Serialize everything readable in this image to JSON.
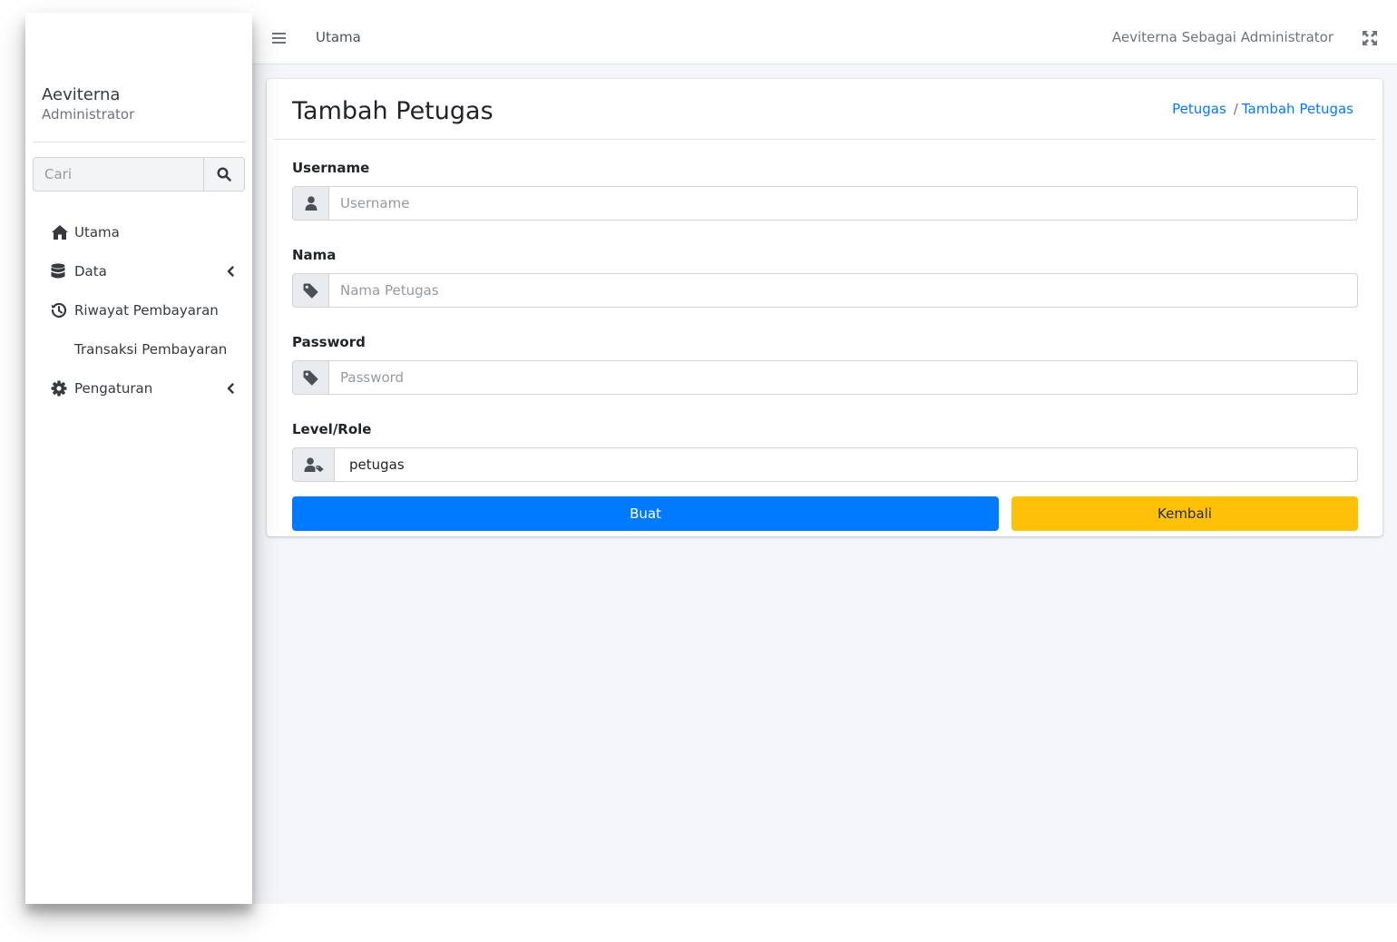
{
  "sidebar": {
    "user_name": "Aeviterna",
    "user_role": "Administrator",
    "search_placeholder": "Cari",
    "items": [
      {
        "label": "Utama",
        "icon": "home-icon",
        "has_chevron": false
      },
      {
        "label": "Data",
        "icon": "database-icon",
        "has_chevron": true
      },
      {
        "label": "Riwayat Pembayaran",
        "icon": "history-icon",
        "has_chevron": false
      },
      {
        "label": "Transaksi Pembayaran",
        "icon": "",
        "has_chevron": false
      },
      {
        "label": "Pengaturan",
        "icon": "gear-icon",
        "has_chevron": true
      }
    ]
  },
  "topbar": {
    "nav_link": "Utama",
    "user_text": "Aeviterna Sebagai Administrator"
  },
  "page": {
    "title": "Tambah Petugas",
    "breadcrumb": [
      {
        "label": "Petugas"
      },
      {
        "label": "Tambah Petugas"
      }
    ]
  },
  "form": {
    "username": {
      "label": "Username",
      "placeholder": "Username",
      "value": "",
      "icon": "user-icon"
    },
    "nama": {
      "label": "Nama",
      "placeholder": "Nama Petugas",
      "value": "",
      "icon": "tag-icon"
    },
    "password": {
      "label": "Password",
      "placeholder": "Password",
      "value": "",
      "icon": "tag-icon"
    },
    "level": {
      "label": "Level/Role",
      "selected": "petugas",
      "icon": "user-tag-icon"
    },
    "submit_label": "Buat",
    "back_label": "Kembali"
  },
  "colors": {
    "primary": "#007bff",
    "warning": "#ffc107",
    "content_bg": "#f4f6f9"
  }
}
